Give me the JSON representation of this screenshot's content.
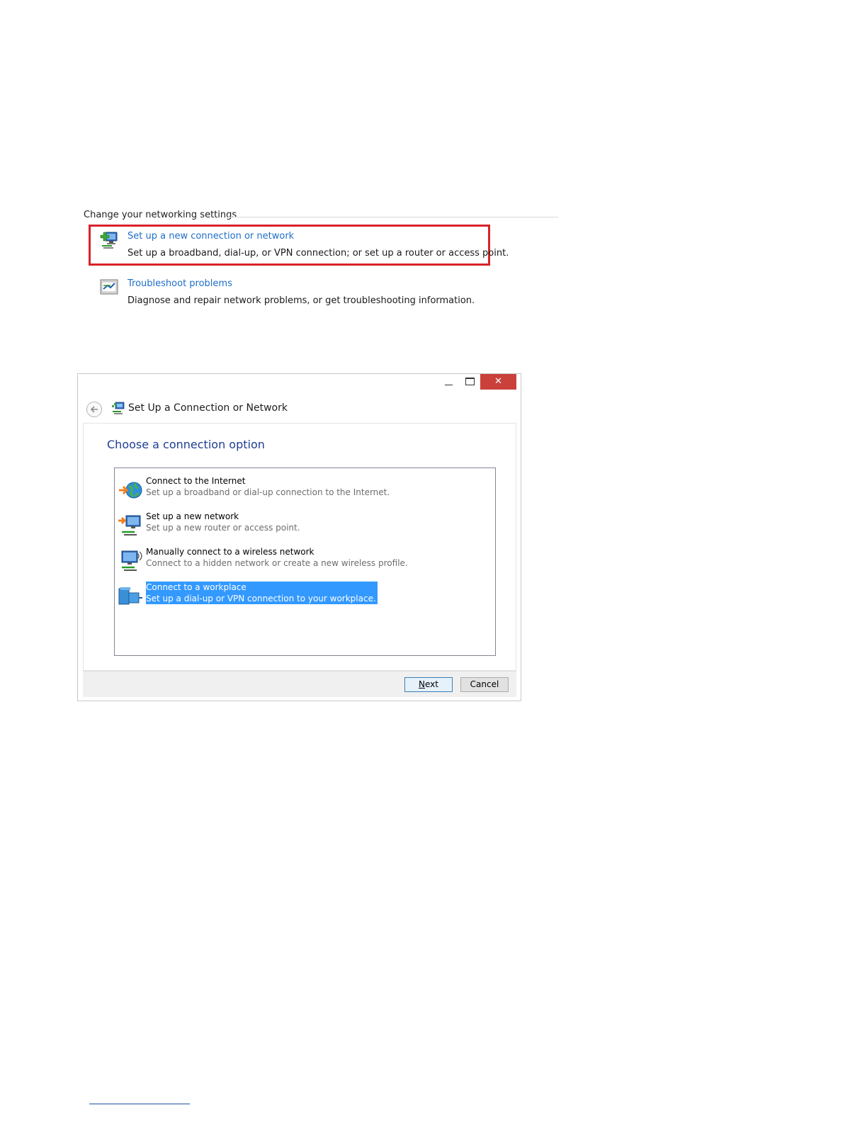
{
  "settings_panel": {
    "header": "Change your networking settings",
    "tasks": [
      {
        "link": "Set up a new connection or network",
        "description": "Set up a broadband, dial-up, or VPN connection; or set up a router or access point.",
        "icon": "network-setup-icon",
        "highlighted": true
      },
      {
        "link": "Troubleshoot problems",
        "description": "Diagnose and repair network problems, or get troubleshooting information.",
        "icon": "troubleshoot-icon",
        "highlighted": false
      }
    ],
    "highlight_color": "#d9222a"
  },
  "dialog": {
    "title": "Set Up a Connection or Network",
    "close_glyph": "✕",
    "heading": "Choose a connection option",
    "options": [
      {
        "title": "Connect to the Internet",
        "description": "Set up a broadband or dial-up connection to the Internet.",
        "icon": "globe-connect-icon",
        "selected": false
      },
      {
        "title": "Set up a new network",
        "description": "Set up a new router or access point.",
        "icon": "new-network-icon",
        "selected": false
      },
      {
        "title": "Manually connect to a wireless network",
        "description": "Connect to a hidden network or create a new wireless profile.",
        "icon": "wireless-network-icon",
        "selected": false
      },
      {
        "title": "Connect to a workplace",
        "description": "Set up a dial-up or VPN connection to your workplace.",
        "icon": "workplace-icon",
        "selected": true
      }
    ],
    "buttons": {
      "next": "Next",
      "cancel": "Cancel"
    },
    "colors": {
      "heading": "#1f3d94",
      "selection": "#3399ff",
      "close": "#c9413a"
    }
  }
}
